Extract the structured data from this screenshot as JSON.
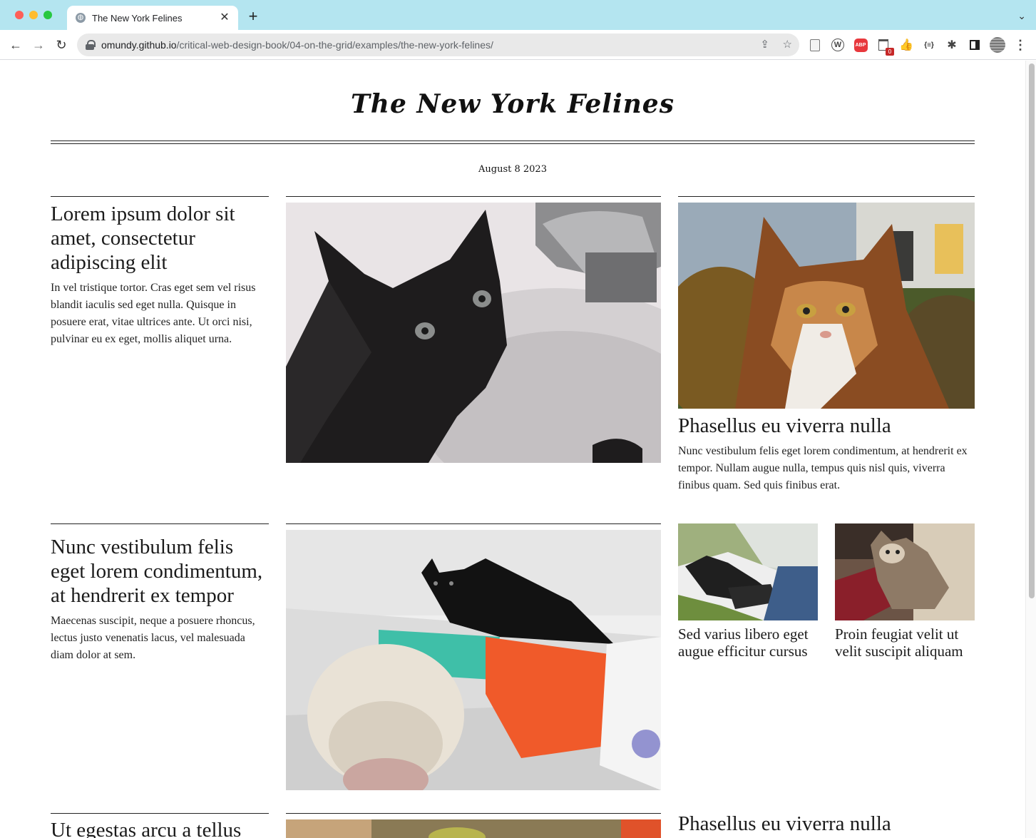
{
  "browser": {
    "tab_title": "The New York Felines",
    "new_tab_symbol": "+",
    "url_host": "omundy.github.io",
    "url_path": "/critical-web-design-book/04-on-the-grid/examples/the-new-york-felines/",
    "extensions": {
      "abp_label": "ABP",
      "trash_badge": "0",
      "json_label": "{≡}"
    }
  },
  "page": {
    "masthead": "The New York Felines",
    "date": "August 8 2023",
    "row1": {
      "left": {
        "headline": "Lorem ipsum dolor sit amet, consectetur adipiscing elit",
        "body": "In vel tristique tortor. Cras eget sem vel risus blandit iaculis sed eget nulla. Quisque in posuere erat, vitae ultrices ante. Ut orci nisi, pulvinar eu ex eget, mollis aliquet urna."
      },
      "right": {
        "headline": "Phasellus eu viverra nulla",
        "body": "Nunc vestibulum felis eget lorem condimentum, at hendrerit ex tempor. Nullam augue nulla, tempus quis nisl quis, viverra finibus quam. Sed quis finibus erat."
      }
    },
    "row2": {
      "left": {
        "headline": "Nunc vestibulum felis eget lorem condimentum, at hendrerit ex tempor",
        "body": "Maecenas suscipit, neque a posuere rhoncus, lectus justo venenatis lacus, vel malesuada diam dolor at sem."
      },
      "right_a": {
        "headline": "Sed varius libero eget augue efficitur cursus"
      },
      "right_b": {
        "headline": "Proin feugiat velit ut velit suscipit aliquam"
      }
    },
    "row3": {
      "left": {
        "headline": "Ut egestas arcu a tellus"
      },
      "right": {
        "headline": "Phasellus eu viverra nulla"
      }
    }
  },
  "colors": {
    "tabstrip": "#b4e5f0",
    "rule": "#222222",
    "text": "#1b1b1b"
  }
}
